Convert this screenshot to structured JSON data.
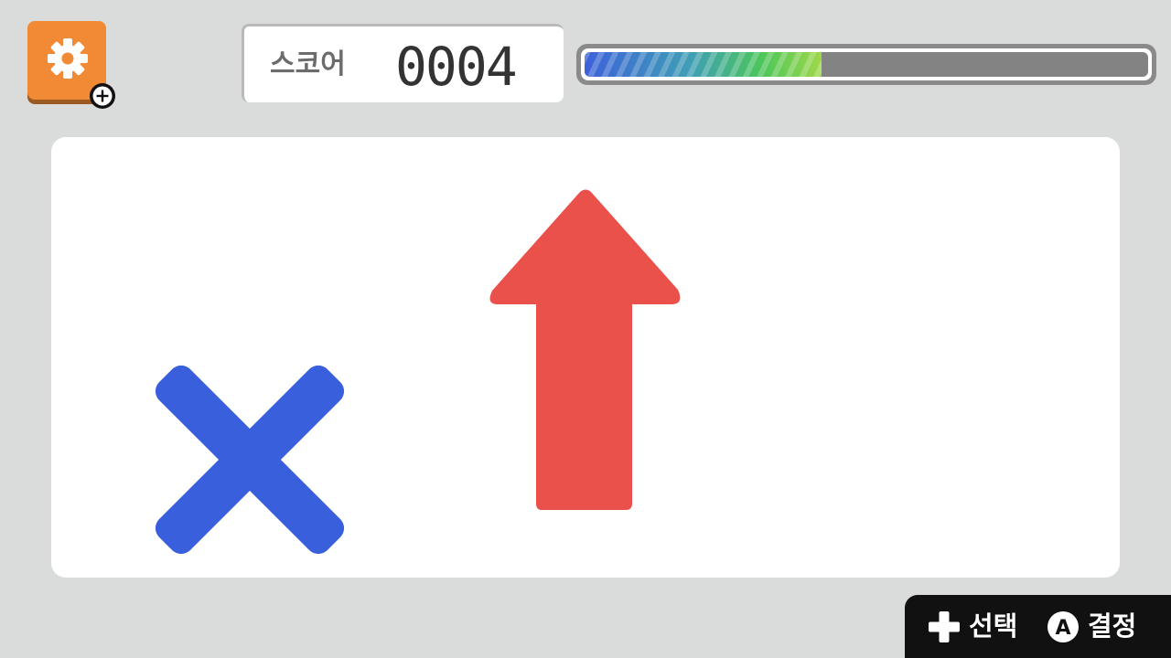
{
  "settings": {
    "icon": "gear-icon",
    "badge_icon": "plus-circle-icon",
    "button_color": "#f08a35"
  },
  "score": {
    "label": "스코어",
    "value": "0004"
  },
  "progress": {
    "fraction": 0.42,
    "fill_colors": [
      "#3d62da",
      "#4dc65a",
      "#9ed84a"
    ]
  },
  "stage": {
    "symbols": [
      {
        "type": "cross",
        "icon": "x-mark-icon",
        "color": "#3a5fdc"
      },
      {
        "type": "arrow-up",
        "icon": "arrow-up-icon",
        "color": "#eb514b"
      }
    ]
  },
  "controls": {
    "select_icon": "dpad-plus-icon",
    "select_label": "선택",
    "confirm_icon": "a-button-icon",
    "confirm_button_letter": "A",
    "confirm_label": "결정"
  }
}
